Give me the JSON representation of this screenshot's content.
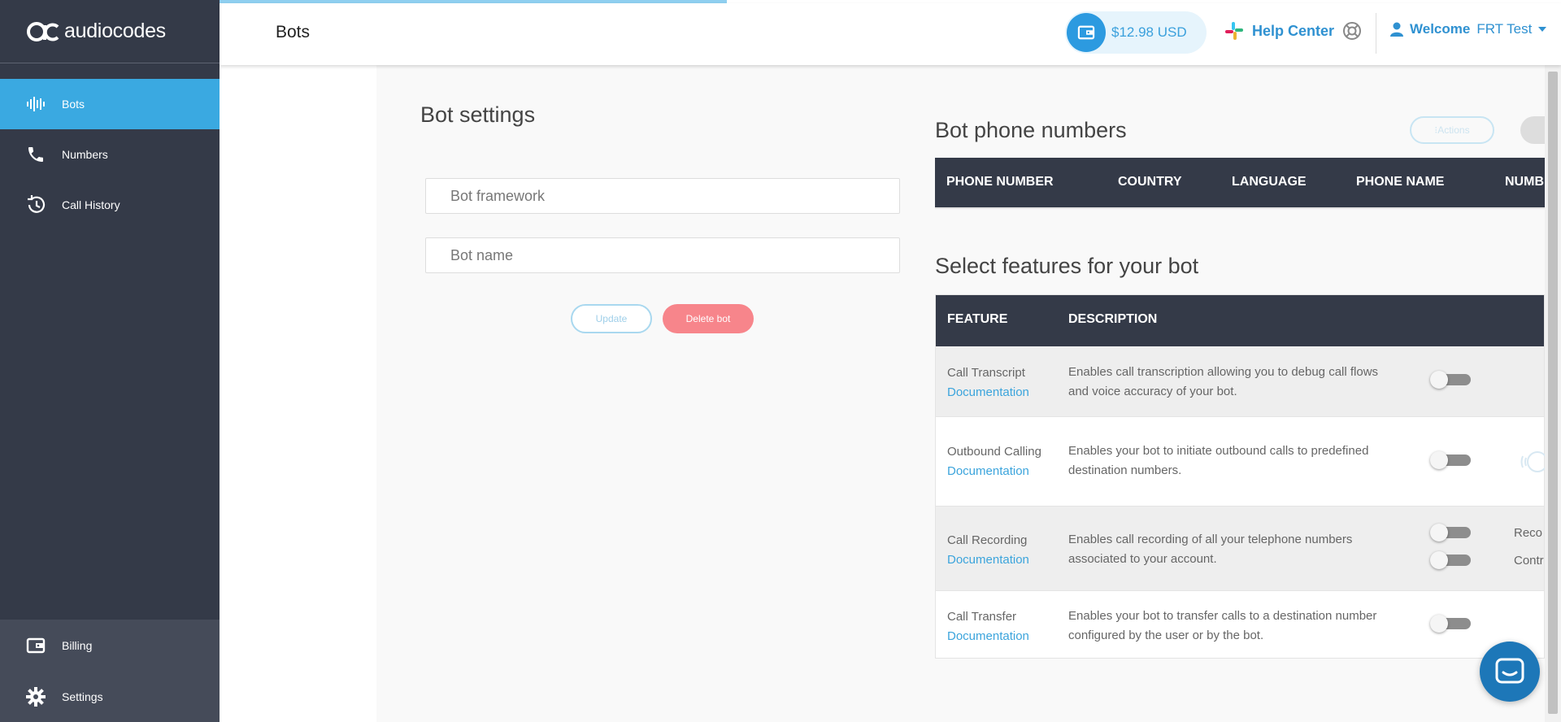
{
  "brand": {
    "logo_text": "audiocodes"
  },
  "sidebar": {
    "items": [
      {
        "label": "Bots",
        "icon": "waveform-icon",
        "active": true
      },
      {
        "label": "Numbers",
        "icon": "phone-icon"
      },
      {
        "label": "Call History",
        "icon": "history-icon"
      }
    ],
    "bottom_items": [
      {
        "label": "Billing",
        "icon": "wallet-icon"
      },
      {
        "label": "Settings",
        "icon": "gear-icon"
      }
    ]
  },
  "header": {
    "title": "Bots",
    "balance": "$12.98 USD",
    "help_label": "Help Center",
    "welcome_label": "Welcome",
    "user_name": "FRT Test"
  },
  "bot_settings": {
    "title": "Bot settings",
    "framework_placeholder": "Bot framework",
    "name_placeholder": "Bot name",
    "update_label": "Update",
    "delete_label": "Delete bot"
  },
  "phone_numbers": {
    "title": "Bot phone numbers",
    "actions_label": "⁝Actions",
    "columns": [
      "PHONE NUMBER",
      "COUNTRY",
      "LANGUAGE",
      "PHONE NAME",
      "NUMB"
    ]
  },
  "features": {
    "title": "Select features for your bot",
    "columns": [
      "FEATURE",
      "DESCRIPTION"
    ],
    "rows": [
      {
        "name": "Call Transcript",
        "doc": "Documentation",
        "desc_line1": "Enables call transcription allowing you to debug call flows",
        "desc_line2": "and voice accuracy of your bot.",
        "enabled": false
      },
      {
        "name": "Outbound Calling",
        "doc": "Documentation",
        "desc_line1": "Enables your bot to initiate outbound calls to predefined",
        "desc_line2": "destination numbers.",
        "enabled": false
      },
      {
        "name": "Call Recording",
        "doc": "Documentation",
        "desc_line1": "Enables call recording of all your telephone numbers",
        "desc_line2": "associated to your account.",
        "enabled": false,
        "extra1": "Reco",
        "extra2": "Contr"
      },
      {
        "name": "Call Transfer",
        "doc": "Documentation",
        "desc_line1": "Enables your bot to transfer calls to a destination number",
        "desc_line2": "configured by the user or by the bot.",
        "enabled": false
      }
    ]
  },
  "colors": {
    "sidebar": "#343a48",
    "accent": "#3aa9e1",
    "danger": "#f7858b",
    "link": "#3ba4dc"
  }
}
